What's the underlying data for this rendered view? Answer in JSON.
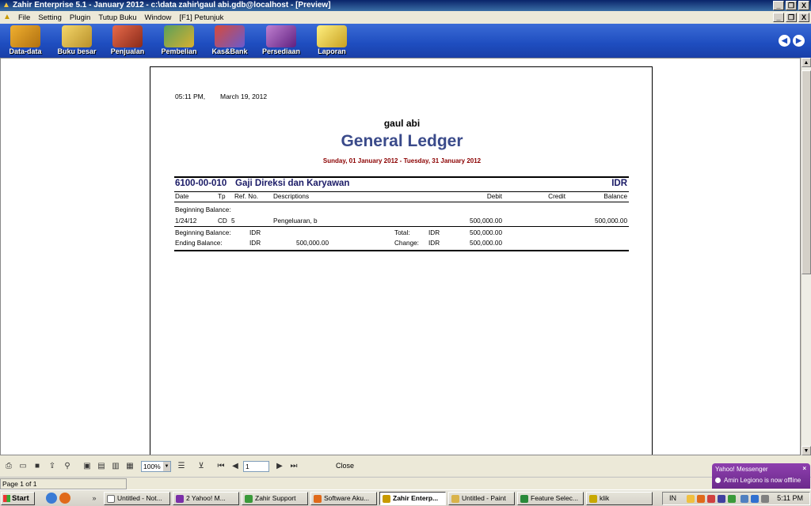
{
  "window": {
    "title": "Zahir Enterprise 5.1 - January 2012 - c:\\data zahir\\gaul abi.gdb@localhost - [Preview]",
    "min_label": "_",
    "restore_label": "❐",
    "close_label": "X"
  },
  "menu": [
    "File",
    "Setting",
    "Plugin",
    "Tutup Buku",
    "Window",
    "[F1] Petunjuk"
  ],
  "modules": [
    {
      "label": "Data-data",
      "color": "#e8a020"
    },
    {
      "label": "Buku besar",
      "color": "#e7c24a"
    },
    {
      "label": "Penjualan",
      "color": "#d14b3a"
    },
    {
      "label": "Pembelian",
      "color": "#3b7a3b"
    },
    {
      "label": "Kas&Bank",
      "color": "#c0392b"
    },
    {
      "label": "Persediaan",
      "color": "#a050b0"
    },
    {
      "label": "Laporan",
      "color": "#f0d040"
    }
  ],
  "report": {
    "time": "05:11 PM,",
    "date": "March 19, 2012",
    "company": "gaul abi",
    "title": "General Ledger",
    "range": "Sunday, 01 January 2012 - Tuesday, 31 January 2012",
    "account_code": "6100-00-010",
    "account_name": "Gaji Direksi dan Karyawan",
    "currency": "IDR",
    "columns": {
      "date": "Date",
      "tp": "Tp",
      "ref": "Ref. No.",
      "desc": "Descriptions",
      "debit": "Debit",
      "credit": "Credit",
      "balance": "Balance"
    },
    "beginning_label": "Beginning Balance:",
    "row": {
      "date": "1/24/12",
      "tp": "CD",
      "ref": "5",
      "desc": "Pengeluaran, b",
      "debit": "500,000.00",
      "credit": "",
      "balance": "500,000.00"
    },
    "summary": {
      "begin_label": "Beginning Balance:",
      "begin_cur": "IDR",
      "begin_val": "",
      "end_label": "Ending Balance:",
      "end_cur": "IDR",
      "end_val": "500,000.00",
      "total_label": "Total:",
      "total_cur": "IDR",
      "total_val": "500,000.00",
      "change_label": "Change:",
      "change_cur": "IDR",
      "change_val": "500,000.00"
    }
  },
  "preview_toolbar": {
    "zoom": "100%",
    "page_input": "1",
    "close_label": "Close"
  },
  "status": {
    "page": "Page 1 of 1"
  },
  "yahoo": {
    "title": "Yahoo! Messenger",
    "message": "Amin Legiono is now offline"
  },
  "taskbar": {
    "start": "Start",
    "tasks": [
      {
        "label": "Untitled - Not...",
        "color": "#ffffff",
        "active": false
      },
      {
        "label": "2 Yahoo! M...",
        "color": "#7b2fa8",
        "active": false
      },
      {
        "label": "Zahir Support",
        "color": "#3a9a3a",
        "active": false
      },
      {
        "label": "Software Aku...",
        "color": "#e06a1a",
        "active": false
      },
      {
        "label": "Zahir Enterp...",
        "color": "#c89a00",
        "active": true
      },
      {
        "label": "Untitled - Paint",
        "color": "#d9b34a",
        "active": false
      },
      {
        "label": "Feature Selec...",
        "color": "#2a8a3a",
        "active": false
      },
      {
        "label": "klik",
        "color": "#c8a800",
        "active": false
      }
    ],
    "lang": "IN",
    "clock": "5:11 PM"
  }
}
